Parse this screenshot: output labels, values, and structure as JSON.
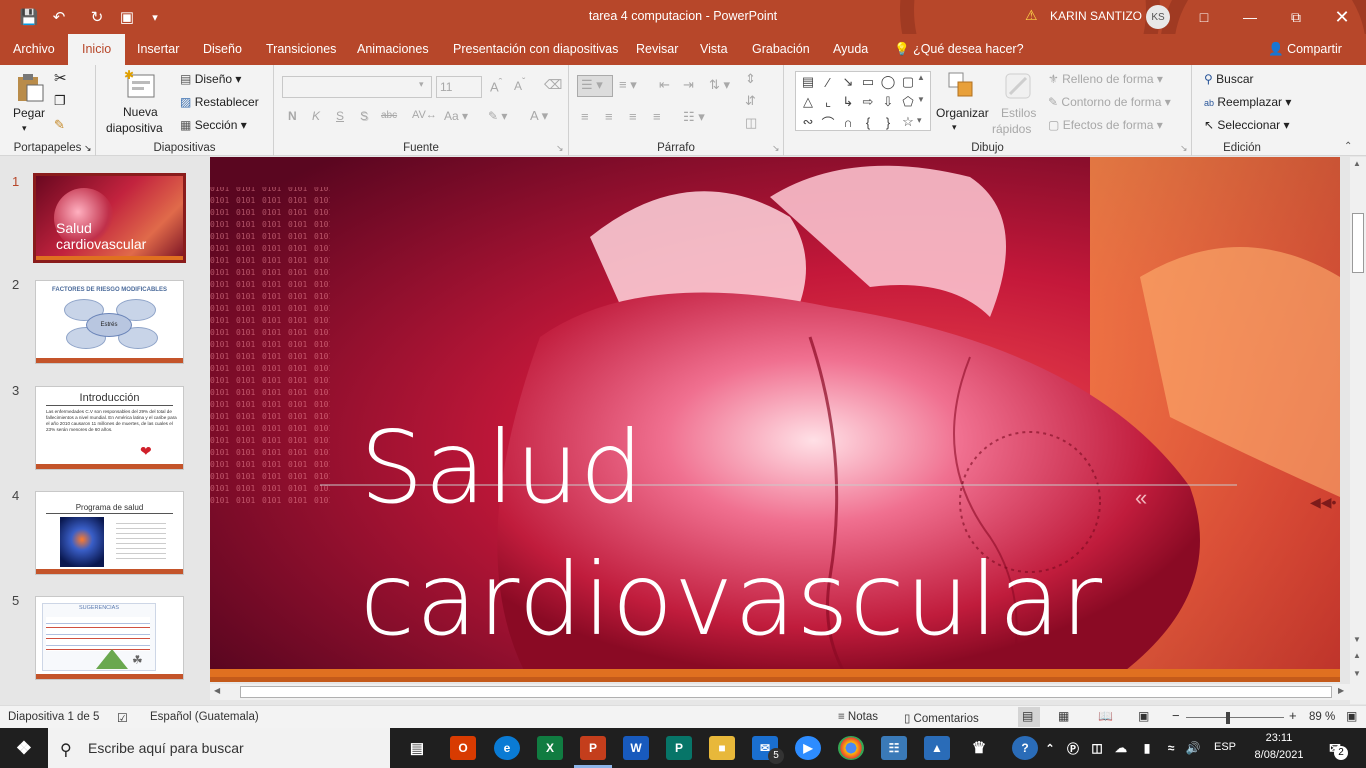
{
  "app": {
    "doc_title": "tarea 4 computacion  -  PowerPoint",
    "user_name": "KARIN SANTIZO",
    "user_initials": "KS"
  },
  "tabs": [
    {
      "label": "Archivo"
    },
    {
      "label": "Inicio"
    },
    {
      "label": "Insertar"
    },
    {
      "label": "Diseño"
    },
    {
      "label": "Transiciones"
    },
    {
      "label": "Animaciones"
    },
    {
      "label": "Presentación con diapositivas"
    },
    {
      "label": "Revisar"
    },
    {
      "label": "Vista"
    },
    {
      "label": "Grabación"
    },
    {
      "label": "Ayuda"
    }
  ],
  "tell_me": "¿Qué desea hacer?",
  "share": "Compartir",
  "ribbon": {
    "clipboard": {
      "paste": "Pegar",
      "label": "Portapapeles"
    },
    "slides": {
      "new_line1": "Nueva",
      "new_line2": "diapositiva",
      "layout": "Diseño",
      "reset": "Restablecer",
      "section": "Sección",
      "label": "Diapositivas"
    },
    "font": {
      "size": "11",
      "label": "Fuente",
      "b": "N",
      "i": "K",
      "u": "S",
      "s": "S",
      "strike": "abc",
      "aa": "Aa"
    },
    "paragraph": {
      "label": "Párrafo"
    },
    "drawing": {
      "arrange": "Organizar",
      "styles_line1": "Estilos",
      "styles_line2": "rápidos",
      "fill": "Relleno de forma",
      "outline": "Contorno de forma",
      "effects": "Efectos de forma",
      "label": "Dibujo"
    },
    "editing": {
      "find": "Buscar",
      "replace": "Reemplazar",
      "select": "Seleccionar",
      "label": "Edición"
    }
  },
  "slides": [
    {
      "num": "1",
      "title_line1": "Salud",
      "title_line2": "cardiovascular"
    },
    {
      "num": "2",
      "title": "FACTORES DE RIESGO MODIFICABLES",
      "center": "Estrés"
    },
    {
      "num": "3",
      "title": "Introducción",
      "body": "Las enfermedades C.V son responsables del 29% del total de fallecimientos a nivel mundial. En América latina y el caribe para el año 2010 causaron 11 millones de muertes, de las cuales el 23% serán menores de 60 años."
    },
    {
      "num": "4",
      "title": "Programa de salud"
    },
    {
      "num": "5",
      "title": "SUGERENCIAS"
    }
  ],
  "main_slide": {
    "line1": "Salud",
    "line2": "cardiovascular"
  },
  "status": {
    "slide_of": "Diapositiva 1 de 5",
    "language": "Español (Guatemala)",
    "notes": "Notas",
    "comments": "Comentarios",
    "zoom": "89 %"
  },
  "taskbar": {
    "search_placeholder": "Escribe aquí para buscar",
    "lang": "ESP",
    "time": "23:11",
    "date": "8/08/2021",
    "notif_count": "2",
    "zoom_badge": "5"
  }
}
